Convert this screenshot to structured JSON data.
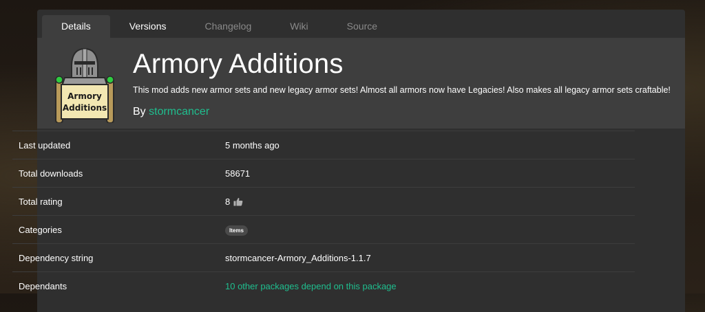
{
  "tabs": [
    {
      "label": "Details",
      "active": true
    },
    {
      "label": "Versions",
      "active": false
    },
    {
      "label": "Changelog",
      "active": false
    },
    {
      "label": "Wiki",
      "active": false
    },
    {
      "label": "Source",
      "active": false
    }
  ],
  "package": {
    "title": "Armory Additions",
    "description": "This mod adds new armor sets and new legacy armor sets! Almost all armors now have Legacies! Also makes all legacy armor sets craftable!",
    "by_label": "By",
    "author": "stormcancer",
    "logo_text_line1": "Armory",
    "logo_text_line2": "Additions"
  },
  "details": {
    "last_updated_label": "Last updated",
    "last_updated_value": "5 months ago",
    "downloads_label": "Total downloads",
    "downloads_value": "58671",
    "rating_label": "Total rating",
    "rating_value": "8",
    "categories_label": "Categories",
    "category_badge": "Items",
    "dependency_label": "Dependency string",
    "dependency_value": "stormcancer-Armory_Additions-1.1.7",
    "dependants_label": "Dependants",
    "dependants_value": "10 other packages depend on this package"
  },
  "icons": {
    "rating": "thumbs-up-icon",
    "logo": "knight-helmet-scroll"
  },
  "colors": {
    "accent_green": "#1fbf8f",
    "card_bg": "#2f2f2f",
    "header_bg": "#3e3e3e"
  }
}
